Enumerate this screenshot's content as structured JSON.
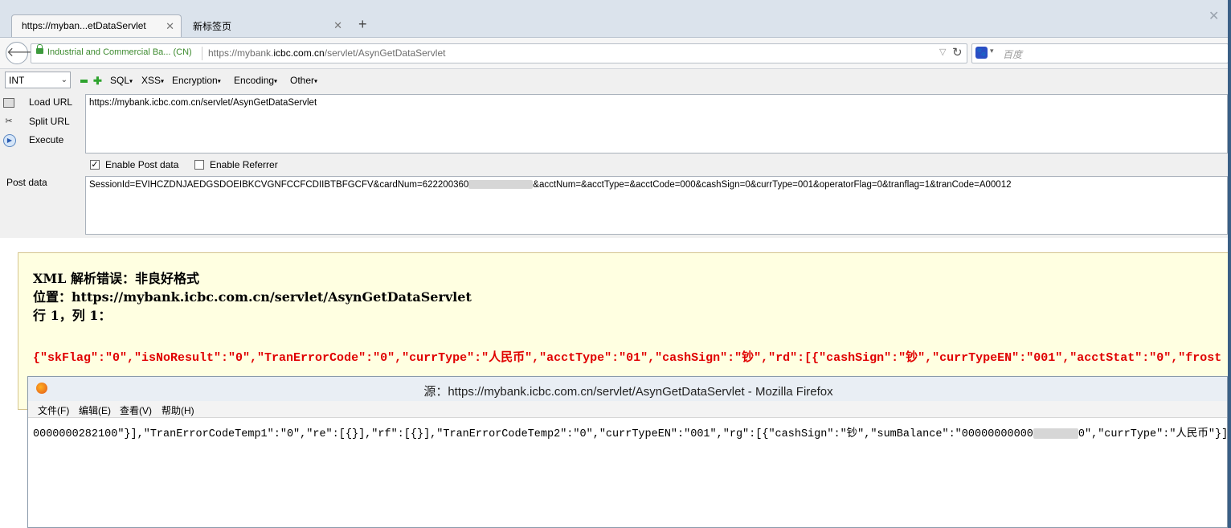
{
  "tabs": [
    {
      "label": "https://myban...etDataServlet",
      "active": true
    },
    {
      "label": "新标签页",
      "active": false
    }
  ],
  "nav": {
    "identity": "Industrial and Commercial Ba... (CN)",
    "url_prefix": "https://mybank.",
    "url_domain": "icbc.com.cn",
    "url_path": "/servlet/AsynGetDataServlet",
    "search_engine_icon": "baidu-paw-icon",
    "search_placeholder": "百度"
  },
  "hackbar": {
    "type_select": "INT",
    "menus": [
      "SQL",
      "XSS",
      "Encryption",
      "Encoding",
      "Other"
    ],
    "actions": [
      "Load URL",
      "Split URL",
      "Execute"
    ],
    "url_value": "https://mybank.icbc.com.cn/servlet/AsynGetDataServlet",
    "enable_post_label": "Enable Post data",
    "enable_post_checked": true,
    "enable_referrer_label": "Enable Referrer",
    "enable_referrer_checked": false,
    "post_label": "Post data",
    "post_value_start": "SessionId=EVIHCZDNJAEDGSDOEIBKCVGNFCCFCDIIBTBFGCFV&cardNum=622200360",
    "post_value_end": "&acctNum=&acctType=&acctCode=000&cashSign=0&currType=001&operatorFlag=0&tranflag=1&tranCode=A00012"
  },
  "error": {
    "line1": "XML 解析错误：非良好格式",
    "line2": "位置：https://mybank.icbc.com.cn/servlet/AsynGetDataServlet",
    "line3": "行 1，列 1：",
    "source": "{\"skFlag\":\"0\",\"isNoResult\":\"0\",\"TranErrorCode\":\"0\",\"currType\":\"人民币\",\"acctType\":\"01\",\"cashSign\":\"钞\",\"rd\":[{\"cashSign\":\"钞\",\"currTypeEN\":\"001\",\"acctStat\":\"0\",\"frost"
  },
  "source_window": {
    "title": "源：https://mybank.icbc.com.cn/servlet/AsynGetDataServlet - Mozilla Firefox",
    "menu": [
      "文件(F)",
      "编辑(E)",
      "查看(V)",
      "帮助(H)"
    ],
    "line_start": "0000000282100\"}],\"TranErrorCodeTemp1\":\"0\",\"re\":[{}],\"rf\":[{}],\"TranErrorCodeTemp2\":\"0\",\"currTypeEN\":\"001\",\"rg\":[{\"cashSign\":\"钞\",\"sumBalance\":\"00000000000",
    "line_end": "0\",\"currType\":\"人民币\"}],\"r"
  }
}
